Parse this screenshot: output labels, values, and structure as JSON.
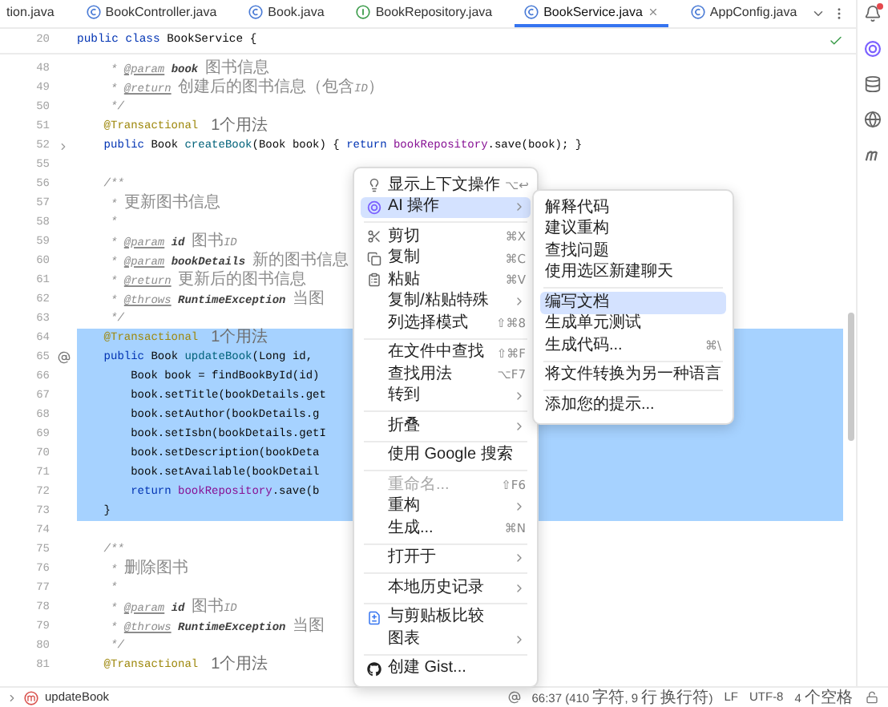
{
  "tabs": [
    {
      "label": "tion.java",
      "selected": false
    },
    {
      "label": "BookController.java",
      "kind": "class",
      "selected": false
    },
    {
      "label": "Book.java",
      "kind": "class",
      "selected": false
    },
    {
      "label": "BookRepository.java",
      "kind": "interface",
      "selected": false
    },
    {
      "label": "BookService.java",
      "kind": "class",
      "selected": true
    },
    {
      "label": "AppConfig.java",
      "kind": "class",
      "selected": false
    }
  ],
  "sticky_line": {
    "number": "20",
    "segments": [
      {
        "kind": "kw",
        "text": "public class "
      },
      {
        "kind": "plain",
        "text": "BookService {"
      }
    ]
  },
  "lines": [
    {
      "number": "48",
      "selected": false,
      "segments": [
        {
          "kind": "doc",
          "text": "     * "
        },
        {
          "kind": "doctag",
          "text": "@param"
        },
        {
          "kind": "docparam",
          "text": " book"
        },
        {
          "kind": "doc",
          "text": " 图书信息"
        }
      ]
    },
    {
      "number": "49",
      "selected": false,
      "segments": [
        {
          "kind": "doc",
          "text": "     * "
        },
        {
          "kind": "doctag",
          "text": "@return"
        },
        {
          "kind": "doc",
          "text": " 创建后的图书信息（包含ID）"
        }
      ]
    },
    {
      "number": "50",
      "selected": false,
      "segments": [
        {
          "kind": "doc",
          "text": "     */"
        }
      ]
    },
    {
      "number": "51",
      "selected": false,
      "segments": [
        {
          "kind": "ann",
          "text": "    @Transactional"
        }
      ],
      "hint": "1个用法"
    },
    {
      "number": "52",
      "selected": false,
      "kind": "fold",
      "segments": [
        {
          "kind": "kw",
          "text": "    public "
        },
        {
          "kind": "plain",
          "text": "Book "
        },
        {
          "kind": "fn",
          "text": "createBook"
        },
        {
          "kind": "plain",
          "text": "(Book book) { "
        },
        {
          "kind": "kw",
          "text": "return "
        },
        {
          "kind": "field",
          "text": "bookRepository"
        },
        {
          "kind": "plain",
          "text": ".save(book); }"
        }
      ]
    },
    {
      "number": "55",
      "selected": false
    },
    {
      "number": "56",
      "selected": false,
      "segments": [
        {
          "kind": "doc",
          "text": "    /**"
        }
      ]
    },
    {
      "number": "57",
      "selected": false,
      "segments": [
        {
          "kind": "doc",
          "text": "     * 更新图书信息"
        }
      ]
    },
    {
      "number": "58",
      "selected": false,
      "segments": [
        {
          "kind": "doc",
          "text": "     *"
        }
      ]
    },
    {
      "number": "59",
      "selected": false,
      "segments": [
        {
          "kind": "doc",
          "text": "     * "
        },
        {
          "kind": "doctag",
          "text": "@param"
        },
        {
          "kind": "docparam",
          "text": " id"
        },
        {
          "kind": "doc",
          "text": " 图书ID"
        }
      ]
    },
    {
      "number": "60",
      "selected": false,
      "segments": [
        {
          "kind": "doc",
          "text": "     * "
        },
        {
          "kind": "doctag",
          "text": "@param"
        },
        {
          "kind": "docparam",
          "text": " bookDetails"
        },
        {
          "kind": "doc",
          "text": " 新的图书信息"
        }
      ]
    },
    {
      "number": "61",
      "selected": false,
      "segments": [
        {
          "kind": "doc",
          "text": "     * "
        },
        {
          "kind": "doctag",
          "text": "@return"
        },
        {
          "kind": "doc",
          "text": " 更新后的图书信息"
        }
      ]
    },
    {
      "number": "62",
      "selected": false,
      "segments": [
        {
          "kind": "doc",
          "text": "     * "
        },
        {
          "kind": "doctag",
          "text": "@throws"
        },
        {
          "kind": "docparam",
          "text": " RuntimeException"
        },
        {
          "kind": "doc",
          "text": " 当图"
        }
      ]
    },
    {
      "number": "63",
      "selected": false,
      "segments": [
        {
          "kind": "doc",
          "text": "     */"
        }
      ]
    },
    {
      "number": "64",
      "selected": true,
      "segments": [
        {
          "kind": "ann",
          "text": "    @Transactional"
        }
      ],
      "hint": "1个用法"
    },
    {
      "number": "65",
      "selected": true,
      "kind": "override",
      "segments": [
        {
          "kind": "kw",
          "text": "    public "
        },
        {
          "kind": "plain",
          "text": "Book "
        },
        {
          "kind": "fn",
          "text": "updateBook"
        },
        {
          "kind": "plain",
          "text": "(Long id,"
        }
      ]
    },
    {
      "number": "66",
      "selected": true,
      "segments": [
        {
          "kind": "plain",
          "text": "        Book book = findBookById(id)"
        }
      ]
    },
    {
      "number": "67",
      "selected": true,
      "segments": [
        {
          "kind": "plain",
          "text": "        book.setTitle(bookDetails.get"
        }
      ]
    },
    {
      "number": "68",
      "selected": true,
      "segments": [
        {
          "kind": "plain",
          "text": "        book.setAuthor(bookDetails.g"
        }
      ]
    },
    {
      "number": "69",
      "selected": true,
      "segments": [
        {
          "kind": "plain",
          "text": "        book.setIsbn(bookDetails.getI"
        }
      ]
    },
    {
      "number": "70",
      "selected": true,
      "segments": [
        {
          "kind": "plain",
          "text": "        book.setDescription(bookDeta"
        }
      ]
    },
    {
      "number": "71",
      "selected": true,
      "segments": [
        {
          "kind": "plain",
          "text": "        book.setAvailable(bookDetail"
        }
      ]
    },
    {
      "number": "72",
      "selected": true,
      "segments": [
        {
          "kind": "kw",
          "text": "        return "
        },
        {
          "kind": "field",
          "text": "bookRepository"
        },
        {
          "kind": "plain",
          "text": ".save(b"
        }
      ]
    },
    {
      "number": "73",
      "selected": true,
      "segments": [
        {
          "kind": "plain",
          "text": "    }"
        }
      ]
    },
    {
      "number": "74",
      "selected": false
    },
    {
      "number": "75",
      "selected": false,
      "segments": [
        {
          "kind": "doc",
          "text": "    /**"
        }
      ]
    },
    {
      "number": "76",
      "selected": false,
      "segments": [
        {
          "kind": "doc",
          "text": "     * 删除图书"
        }
      ]
    },
    {
      "number": "77",
      "selected": false,
      "segments": [
        {
          "kind": "doc",
          "text": "     *"
        }
      ]
    },
    {
      "number": "78",
      "selected": false,
      "segments": [
        {
          "kind": "doc",
          "text": "     * "
        },
        {
          "kind": "doctag",
          "text": "@param"
        },
        {
          "kind": "docparam",
          "text": " id"
        },
        {
          "kind": "doc",
          "text": " 图书ID"
        }
      ]
    },
    {
      "number": "79",
      "selected": false,
      "segments": [
        {
          "kind": "doc",
          "text": "     * "
        },
        {
          "kind": "doctag",
          "text": "@throws"
        },
        {
          "kind": "docparam",
          "text": " RuntimeException"
        },
        {
          "kind": "doc",
          "text": " 当图"
        }
      ]
    },
    {
      "number": "80",
      "selected": false,
      "segments": [
        {
          "kind": "doc",
          "text": "     */"
        }
      ]
    },
    {
      "number": "81",
      "selected": false,
      "segments": [
        {
          "kind": "ann",
          "text": "    @Transactional"
        }
      ],
      "hint": "1个用法"
    }
  ],
  "context_menu": {
    "groups": [
      [
        {
          "label": "显示上下文操作",
          "shortcut": "⌥↩",
          "selected": false,
          "disabled": false
        },
        {
          "label": "AI 操作",
          "has_submenu": true,
          "selected": true,
          "disabled": false
        }
      ],
      [
        {
          "label": "剪切",
          "shortcut": "⌘X",
          "selected": false,
          "disabled": false
        },
        {
          "label": "复制",
          "shortcut": "⌘C",
          "selected": false,
          "disabled": false
        },
        {
          "label": "粘贴",
          "shortcut": "⌘V",
          "selected": false,
          "disabled": false
        },
        {
          "label": "复制/粘贴特殊",
          "has_submenu": true,
          "selected": false,
          "disabled": false
        },
        {
          "label": "列选择模式",
          "shortcut": "⇧⌘8",
          "selected": false,
          "disabled": false
        }
      ],
      [
        {
          "label": "在文件中查找",
          "shortcut": "⇧⌘F",
          "selected": false,
          "disabled": false
        },
        {
          "label": "查找用法",
          "shortcut": "⌥F7",
          "selected": false,
          "disabled": false
        },
        {
          "label": "转到",
          "has_submenu": true,
          "selected": false,
          "disabled": false
        }
      ],
      [
        {
          "label": "折叠",
          "has_submenu": true,
          "selected": false,
          "disabled": false
        }
      ],
      [
        {
          "label": "使用 Google 搜索",
          "selected": false,
          "disabled": false
        }
      ],
      [
        {
          "label": "重命名...",
          "shortcut": "⇧F6",
          "selected": false,
          "disabled": true
        },
        {
          "label": "重构",
          "has_submenu": true,
          "selected": false,
          "disabled": false
        },
        {
          "label": "生成...",
          "shortcut": "⌘N",
          "selected": false,
          "disabled": false
        }
      ],
      [
        {
          "label": "打开于",
          "has_submenu": true,
          "selected": false,
          "disabled": false
        }
      ],
      [
        {
          "label": "本地历史记录",
          "has_submenu": true,
          "selected": false,
          "disabled": false
        }
      ],
      [
        {
          "label": "与剪贴板比较",
          "selected": false,
          "disabled": false
        },
        {
          "label": "图表",
          "has_submenu": true,
          "selected": false,
          "disabled": false
        }
      ],
      [
        {
          "label": "创建 Gist...",
          "selected": false,
          "disabled": false
        }
      ]
    ]
  },
  "submenu": {
    "groups": [
      [
        {
          "label": "解释代码",
          "selected": false
        },
        {
          "label": "建议重构",
          "selected": false
        },
        {
          "label": "查找问题",
          "selected": false
        },
        {
          "label": "使用选区新建聊天",
          "selected": false
        }
      ],
      [
        {
          "label": "编写文档",
          "selected": true
        },
        {
          "label": "生成单元测试",
          "selected": false
        },
        {
          "label": "生成代码...",
          "shortcut": "⌘\\",
          "selected": false
        }
      ],
      [
        {
          "label": "将文件转换为另一种语言",
          "selected": false
        }
      ],
      [
        {
          "label": "添加您的提示...",
          "selected": false
        }
      ]
    ]
  },
  "status_bar": {
    "breadcrumb": "updateBook",
    "position": "66:37 (410 字符, 9 行 换行符)",
    "line_ending": "LF",
    "encoding": "UTF-8",
    "indent": "4 个空格"
  }
}
